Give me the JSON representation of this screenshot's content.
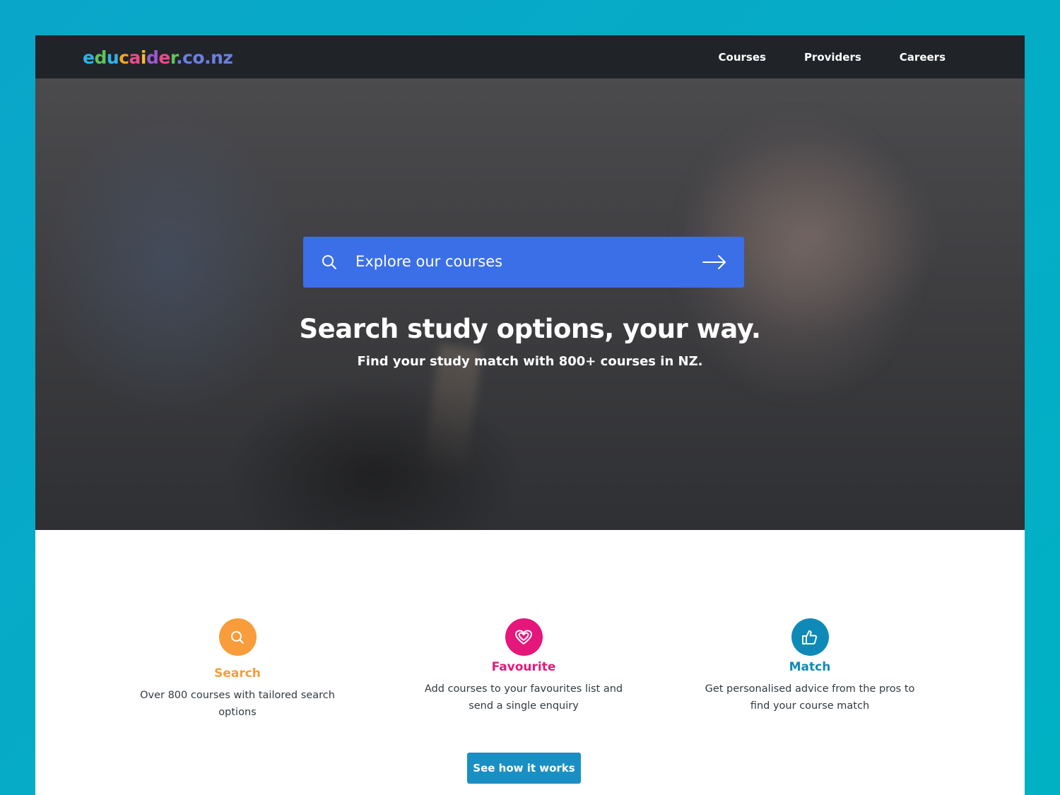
{
  "header": {
    "logo": [
      "e",
      "d",
      "u",
      "c",
      "a",
      "i",
      "d",
      "e",
      "r",
      ".co.nz"
    ],
    "logo_colors": [
      "#2fb3e6",
      "#5fc35a",
      "#2fb3e6",
      "#f5a623",
      "#e94b8a",
      "#f2c029",
      "#9b59d0",
      "#e94b8a",
      "#5fc35a",
      "#2f8fd8"
    ],
    "nav": [
      {
        "label": "Courses"
      },
      {
        "label": "Providers"
      },
      {
        "label": "Careers"
      }
    ]
  },
  "hero": {
    "search_placeholder": "Explore our courses",
    "title": "Search study options, your way.",
    "subtitle": "Find your study match with 800+ courses in NZ."
  },
  "features": [
    {
      "title": "Search",
      "desc": "Over 800 courses with tailored search options",
      "icon": "search-icon",
      "color": "#f89c3c"
    },
    {
      "title": "Favourite",
      "desc": "Add courses to your favourites list and send a single enquiry",
      "icon": "heart-icon",
      "color": "#e5177b"
    },
    {
      "title": "Match",
      "desc": "Get personalised advice from the pros to find your course match",
      "icon": "thumbs-up-icon",
      "color": "#0f8ab8"
    }
  ],
  "cta_label": "See how it works",
  "colors": {
    "navbar": "#202328",
    "search_bar": "#3b6fe8",
    "cta": "#1a8fc3",
    "page_bg": "#0aa6c9"
  }
}
